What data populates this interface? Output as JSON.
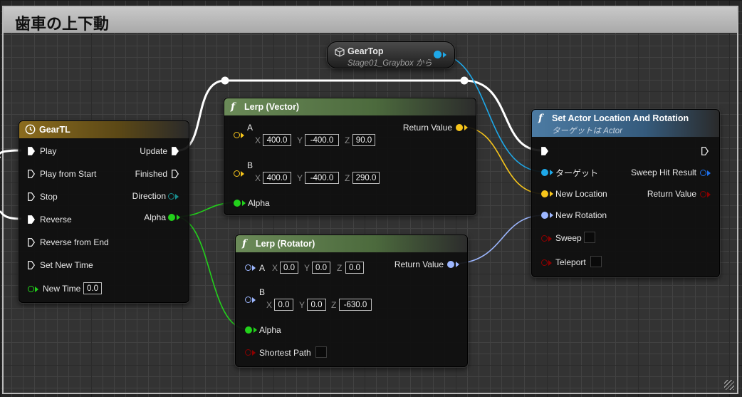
{
  "comment": {
    "title": "歯車の上下動"
  },
  "colors": {
    "exec": "#ffffff",
    "float": "#22d11b",
    "vector": "#f7c51b",
    "rotator": "#9db7ff",
    "object": "#1ea8e8",
    "bool": "#8b0000",
    "direction": "#198c8c",
    "timeline_header": "#7b611b",
    "function_header": "#5c7a4c",
    "call_header": "#3b5a79"
  },
  "geartop": {
    "icon": "cube-icon",
    "title": "GearTop",
    "subtitle": "Stage01_Graybox から"
  },
  "gear_tl": {
    "icon": "clock-icon",
    "title": "GearTL",
    "inputs": [
      "Play",
      "Play from Start",
      "Stop",
      "Reverse",
      "Reverse from End",
      "Set New Time",
      "New Time"
    ],
    "new_time_value": "0.0",
    "outputs": [
      "Update",
      "Finished",
      "Direction",
      "Alpha"
    ]
  },
  "lerp_vector": {
    "icon": "function-icon",
    "title": "Lerp (Vector)",
    "a_label": "A",
    "b_label": "B",
    "alpha_label": "Alpha",
    "return_label": "Return Value",
    "axis_x": "X",
    "axis_y": "Y",
    "axis_z": "Z",
    "a": {
      "x": "400.0",
      "y": "-400.0",
      "z": "90.0"
    },
    "b": {
      "x": "400.0",
      "y": "-400.0",
      "z": "290.0"
    }
  },
  "lerp_rotator": {
    "icon": "function-icon",
    "title": "Lerp (Rotator)",
    "a_label": "A",
    "b_label": "B",
    "alpha_label": "Alpha",
    "shortest_label": "Shortest Path",
    "return_label": "Return Value",
    "axis_x": "X",
    "axis_y": "Y",
    "axis_z": "Z",
    "a": {
      "x": "0.0",
      "y": "0.0",
      "z": "0.0"
    },
    "b": {
      "x": "0.0",
      "y": "0.0",
      "z": "-630.0"
    }
  },
  "set_actor": {
    "icon": "function-icon",
    "title": "Set Actor Location And Rotation",
    "subtitle": "ターゲットは Actor",
    "target_label": "ターゲット",
    "new_location_label": "New Location",
    "new_rotation_label": "New Rotation",
    "sweep_label": "Sweep",
    "teleport_label": "Teleport",
    "sweep_hit_label": "Sweep Hit Result",
    "return_label": "Return Value"
  }
}
